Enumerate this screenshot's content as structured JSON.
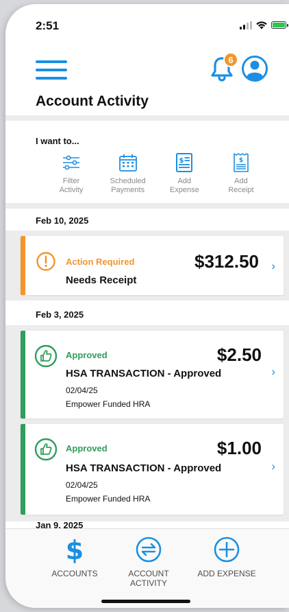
{
  "status_bar": {
    "time": "2:51"
  },
  "header": {
    "notification_count": "6"
  },
  "page_title": "Account Activity",
  "quick_actions": {
    "label": "I want to...",
    "items": [
      {
        "line1": "Filter",
        "line2": "Activity",
        "icon": "filter-sliders-icon"
      },
      {
        "line1": "Scheduled",
        "line2": "Payments",
        "icon": "calendar-icon"
      },
      {
        "line1": "Add",
        "line2": "Expense",
        "icon": "expense-document-icon"
      },
      {
        "line1": "Add",
        "line2": "Receipt",
        "icon": "receipt-icon"
      }
    ]
  },
  "sections": [
    {
      "date": "Feb 10, 2025",
      "cards": [
        {
          "status": "Action Required",
          "amount": "$312.50",
          "title": "Needs Receipt"
        }
      ]
    },
    {
      "date": "Feb 3, 2025",
      "cards": [
        {
          "status": "Approved",
          "amount": "$2.50",
          "title": "HSA TRANSACTION - Approved",
          "date": "02/04/25",
          "account": "Empower Funded HRA"
        },
        {
          "status": "Approved",
          "amount": "$1.00",
          "title": "HSA TRANSACTION - Approved",
          "date": "02/04/25",
          "account": "Empower Funded HRA"
        }
      ]
    },
    {
      "date": "Jan 9, 2025"
    }
  ],
  "bottom_nav": [
    {
      "line1": "ACCOUNTS",
      "line2": "",
      "icon": "dollar-icon"
    },
    {
      "line1": "ACCOUNT",
      "line2": "ACTIVITY",
      "icon": "transfer-arrows-icon"
    },
    {
      "line1": "ADD EXPENSE",
      "line2": "",
      "icon": "plus-circle-icon"
    }
  ],
  "colors": {
    "accent": "#1a8fe3",
    "action_required": "#f3952b",
    "approved": "#2e9e5b",
    "background_band": "#ececec"
  }
}
